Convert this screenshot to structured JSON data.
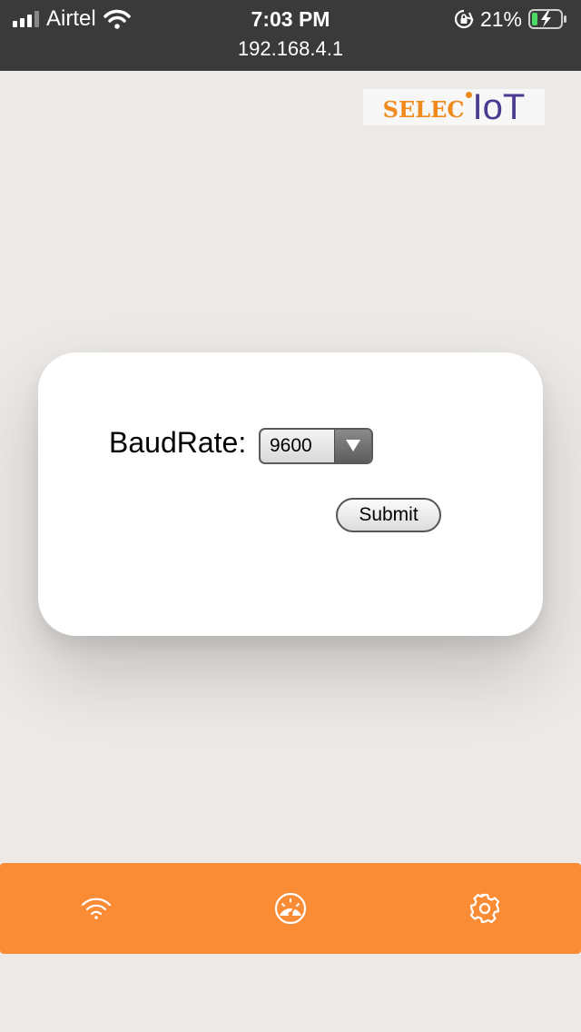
{
  "status_bar": {
    "carrier": "Airtel",
    "time": "7:03 PM",
    "url": "192.168.4.1",
    "battery_percent": "21%",
    "battery_level": 0.21,
    "icons": [
      "signal-icon",
      "wifi-icon",
      "orientation-lock-icon",
      "battery-charging-icon"
    ]
  },
  "logo": {
    "selec": "selec",
    "iot": "IoT",
    "colors": {
      "selec": "#f08a1c",
      "iot": "#4b3a8f"
    }
  },
  "form": {
    "baud_label": "BaudRate:",
    "baud_selected": "9600",
    "submit_label": "Submit"
  },
  "tab_bar": {
    "color": "#fb8c36",
    "tabs": [
      {
        "icon": "wifi-icon"
      },
      {
        "icon": "dashboard-gauge-icon"
      },
      {
        "icon": "settings-gear-icon"
      }
    ]
  }
}
